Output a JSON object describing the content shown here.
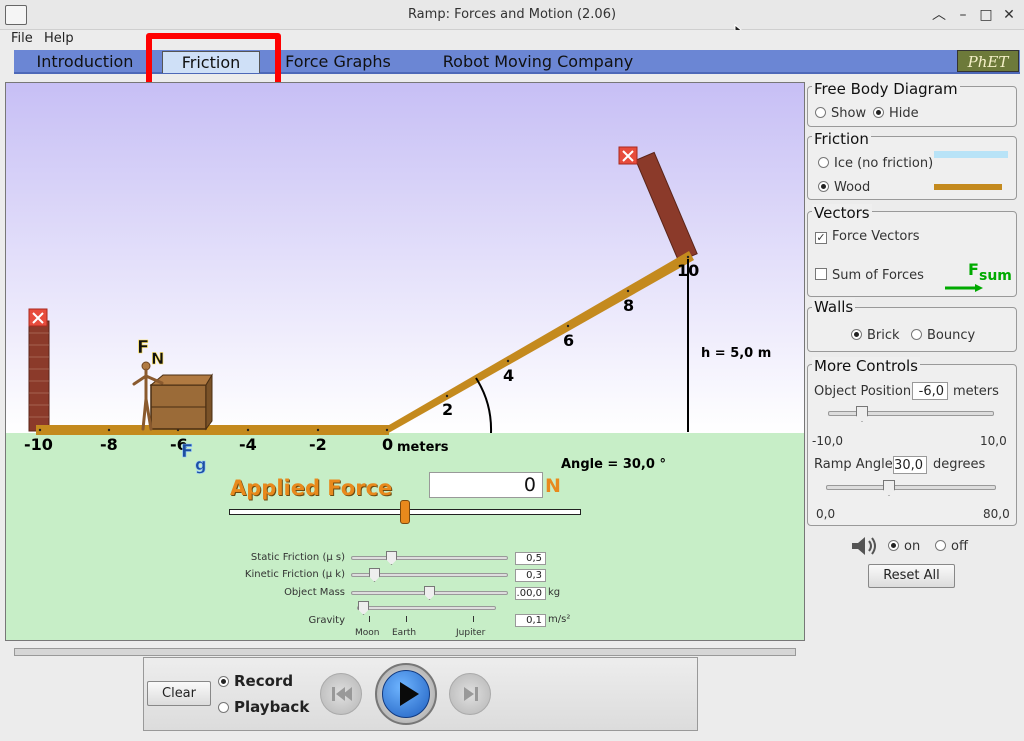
{
  "window": {
    "title": "Ramp: Forces and Motion (2.06)"
  },
  "menu": {
    "file": "File",
    "help": "Help"
  },
  "tabs": [
    "Introduction",
    "Friction",
    "Force Graphs",
    "Robot Moving Company"
  ],
  "logo": "PhET",
  "scene": {
    "ground_ticks": [
      "-10",
      "-8",
      "-6",
      "-4",
      "-2",
      "0"
    ],
    "units": "meters",
    "ramp_ticks": [
      "2",
      "4",
      "6",
      "8",
      "10"
    ],
    "height_label": "h = 5,0 m",
    "angle_label": "Angle = 30,0 °",
    "fn_main": "F",
    "fn_sub": "N",
    "fg_main": "F",
    "fg_sub": "g",
    "applied_force_label": "Applied Force",
    "applied_force_value": "0",
    "applied_force_unit": "N",
    "applied_force_fraction": 0.5
  },
  "params": [
    {
      "label": "Static Friction (μ s)",
      "value": "0,5",
      "unit": ""
    },
    {
      "label": "Kinetic Friction (μ k)",
      "value": "0,3",
      "unit": ""
    },
    {
      "label": "Object Mass",
      "value": ".00,0",
      "unit": "kg"
    },
    {
      "label": "Gravity",
      "value": "0,1",
      "unit": "m/s²"
    }
  ],
  "gravity_marks": [
    "Moon",
    "Earth",
    "Jupiter"
  ],
  "controls": {
    "fbd": {
      "title": "Free Body Diagram",
      "show": "Show",
      "hide": "Hide",
      "selected": "Hide"
    },
    "friction": {
      "title": "Friction",
      "ice": "Ice (no friction)",
      "wood": "Wood",
      "selected": "Wood"
    },
    "vectors": {
      "title": "Vectors",
      "force_vectors": "Force Vectors",
      "force_vectors_checked": true,
      "sum_of_forces": "Sum of Forces",
      "sum_of_forces_checked": false,
      "fsum_main": "F",
      "fsum_sub": "sum"
    },
    "walls": {
      "title": "Walls",
      "brick": "Brick",
      "bouncy": "Bouncy",
      "selected": "Brick"
    },
    "more": {
      "title": "More Controls",
      "object_position_label": "Object Position",
      "object_position_value": "-6,0",
      "object_position_unit": "meters",
      "object_position_min": "-10,0",
      "object_position_max": "10,0",
      "ramp_angle_label": "Ramp Angle",
      "ramp_angle_value": "30,0",
      "ramp_angle_unit": "degrees",
      "ramp_angle_min": "0,0",
      "ramp_angle_max": "80,0"
    },
    "sound": {
      "on": "on",
      "off": "off",
      "selected": "on"
    },
    "reset": "Reset All"
  },
  "playback": {
    "clear": "Clear",
    "record": "Record",
    "playback": "Playback",
    "selected": "Record"
  },
  "colors": {
    "ramp": "#c48a1e",
    "tab_bar": "#6b86d4",
    "highlight": "#ff0000",
    "applied_force": "#e8891c"
  }
}
